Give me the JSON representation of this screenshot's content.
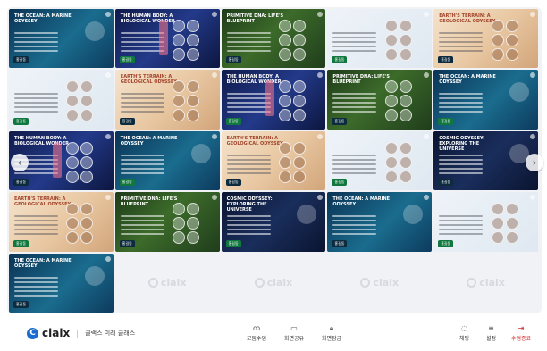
{
  "tiles": [
    {
      "theme": "ocean",
      "title": "THE OCEAN: A MARINE ODYSSEY",
      "tag": "홍길동"
    },
    {
      "theme": "body",
      "title": "THE HUMAN BODY: A BIOLOGICAL WONDER",
      "tag": "홍길동"
    },
    {
      "theme": "primitive",
      "title": "PRIMITIVE DNA: LIFE'S BLUEPRINT",
      "tag": "홍길동"
    },
    {
      "theme": "dna",
      "title": "",
      "tag": "홍길동"
    },
    {
      "theme": "terrain",
      "title": "EARTH'S TERRAIN: A GEOLOGICAL ODYSSEY",
      "tag": "홍길동"
    },
    {
      "theme": "dna",
      "title": "",
      "tag": "홍길동"
    },
    {
      "theme": "terrain",
      "title": "EARTH'S TERRAIN: A GEOLOGICAL ODYSSEY",
      "tag": "홍길동"
    },
    {
      "theme": "body",
      "title": "THE HUMAN BODY: A BIOLOGICAL WONDER",
      "tag": "홍길동"
    },
    {
      "theme": "primitive",
      "title": "PRIMITIVE DNA: LIFE'S BLUEPRINT",
      "tag": "홍길동"
    },
    {
      "theme": "ocean",
      "title": "THE OCEAN: A MARINE ODYSSEY",
      "tag": "홍길동"
    },
    {
      "theme": "body",
      "title": "THE HUMAN BODY: A BIOLOGICAL WONDER",
      "tag": "홍길동"
    },
    {
      "theme": "ocean",
      "title": "THE OCEAN: A MARINE ODYSSEY",
      "tag": "홍길동"
    },
    {
      "theme": "terrain",
      "title": "EARTH'S TERRAIN: A GEOLOGICAL ODYSSEY",
      "tag": "홍길동"
    },
    {
      "theme": "dna",
      "title": "",
      "tag": "홍길동"
    },
    {
      "theme": "cosmic",
      "title": "COSMIC ODYSSEY: EXPLORING THE UNIVERSE",
      "tag": "홍길동"
    },
    {
      "theme": "terrain",
      "title": "EARTH'S TERRAIN: A GEOLOGICAL ODYSSEY",
      "tag": "홍길동"
    },
    {
      "theme": "primitive",
      "title": "PRIMITIVE DNA: LIFE'S BLUEPRINT",
      "tag": "홍길동"
    },
    {
      "theme": "cosmic",
      "title": "COSMIC ODYSSEY: EXPLORING THE UNIVERSE",
      "tag": "홍길동"
    },
    {
      "theme": "ocean",
      "title": "THE OCEAN: A MARINE ODYSSEY",
      "tag": "홍길동"
    },
    {
      "theme": "dna",
      "title": "",
      "tag": "홍길동"
    },
    {
      "theme": "ocean",
      "title": "THE OCEAN: A MARINE ODYSSEY",
      "tag": "홍길동"
    },
    {
      "theme": "empty",
      "watermark": "claix"
    },
    {
      "theme": "empty",
      "watermark": "claix"
    },
    {
      "theme": "empty",
      "watermark": "claix"
    },
    {
      "theme": "empty",
      "watermark": "claix"
    }
  ],
  "footer": {
    "logo": "claix",
    "logo_mark": "C",
    "class_name": "클랙스 미래 클래스",
    "controls": [
      {
        "icon": "group-icon",
        "glyph": "ꝏ",
        "label": "모둠수업"
      },
      {
        "icon": "screen-share-icon",
        "glyph": "▭",
        "label": "화면공유"
      },
      {
        "icon": "lock-icon",
        "glyph": "🔒︎",
        "label": "화면잠금"
      }
    ],
    "right_controls": [
      {
        "icon": "chat-icon",
        "glyph": "◌",
        "label": "채팅",
        "style": "normal"
      },
      {
        "icon": "settings-icon",
        "glyph": "≡",
        "label": "설정",
        "style": "normal"
      },
      {
        "icon": "exit-icon",
        "glyph": "⇥",
        "label": "수업종료",
        "style": "red"
      }
    ]
  },
  "nav": {
    "prev": "‹",
    "next": "›"
  }
}
